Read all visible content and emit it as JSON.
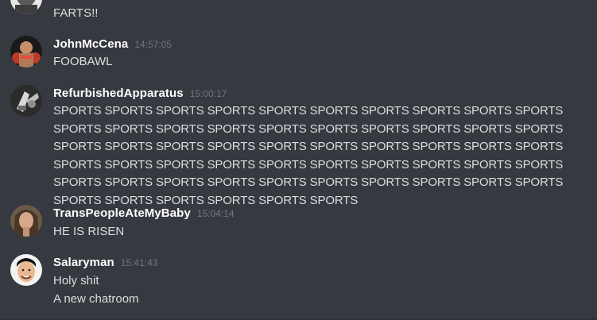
{
  "messages": [
    {
      "author": "",
      "timestamp": "",
      "lines": [
        "FARTS!!"
      ]
    },
    {
      "author": "JohnMcCena",
      "timestamp": "14:57:05",
      "lines": [
        "FOOBAWL"
      ]
    },
    {
      "author": "RefurbishedApparatus",
      "timestamp": "15:00:17",
      "lines": [
        "SPORTS SPORTS SPORTS SPORTS SPORTS SPORTS SPORTS SPORTS SPORTS SPORTS SPORTS SPORTS SPORTS SPORTS SPORTS SPORTS SPORTS SPORTS SPORTS SPORTS SPORTS SPORTS SPORTS SPORTS SPORTS SPORTS SPORTS SPORTS SPORTS SPORTS SPORTS SPORTS SPORTS SPORTS SPORTS SPORTS SPORTS SPORTS SPORTS SPORTS SPORTS SPORTS SPORTS SPORTS SPORTS SPORTS SPORTS SPORTS SPORTS SPORTS SPORTS SPORTS SPORTS SPORTS SPORTS SPORTS"
      ]
    },
    {
      "author": "TransPeopleAteMyBaby",
      "timestamp": "15:04:14",
      "lines": [
        "HE IS RISEN"
      ]
    },
    {
      "author": "Salaryman",
      "timestamp": "15:41:43",
      "lines": [
        "Holy shit",
        "A new chatroom"
      ]
    }
  ],
  "colors": {
    "background": "#36393f",
    "username": "#ffffff",
    "timestamp": "#72767d",
    "message_text": "#dcddde"
  }
}
